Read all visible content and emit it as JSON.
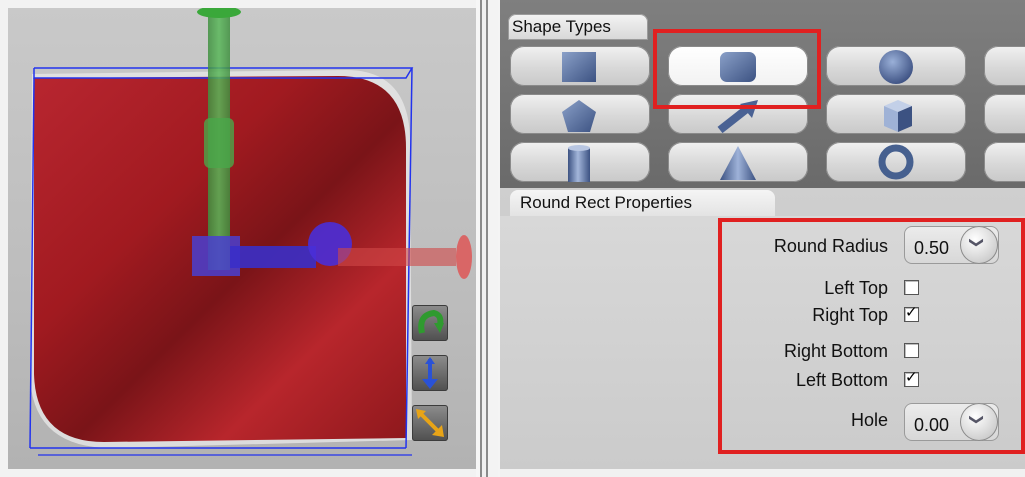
{
  "shape_types": {
    "tab_label": "Shape Types",
    "buttons": [
      {
        "icon": "cube-icon",
        "selected": false
      },
      {
        "icon": "rounded-cube-icon",
        "selected": true
      },
      {
        "icon": "sphere-icon",
        "selected": false
      },
      {
        "icon": "shape-icon",
        "selected": false
      },
      {
        "icon": "pentagon-icon",
        "selected": false
      },
      {
        "icon": "arrow-icon",
        "selected": false
      },
      {
        "icon": "box-icon",
        "selected": false
      },
      {
        "icon": "shape-icon",
        "selected": false
      },
      {
        "icon": "cylinder-icon",
        "selected": false
      },
      {
        "icon": "cone-icon",
        "selected": false
      },
      {
        "icon": "torus-icon",
        "selected": false
      },
      {
        "icon": "shape-icon",
        "selected": false
      }
    ]
  },
  "properties": {
    "tab_label": "Round Rect Properties",
    "round_radius": {
      "label": "Round Radius",
      "value": "0.50"
    },
    "left_top": {
      "label": "Left Top",
      "checked": false
    },
    "right_top": {
      "label": "Right Top",
      "checked": true
    },
    "right_bottom": {
      "label": "Right Bottom",
      "checked": false
    },
    "left_bottom": {
      "label": "Left Bottom",
      "checked": true
    },
    "hole": {
      "label": "Hole",
      "value": "0.00"
    }
  },
  "viewport": {
    "object_color": "#a81c22",
    "gizmo_tools": [
      "rotate-icon",
      "move-icon",
      "scale-icon"
    ]
  },
  "highlight_color": "#e02020"
}
